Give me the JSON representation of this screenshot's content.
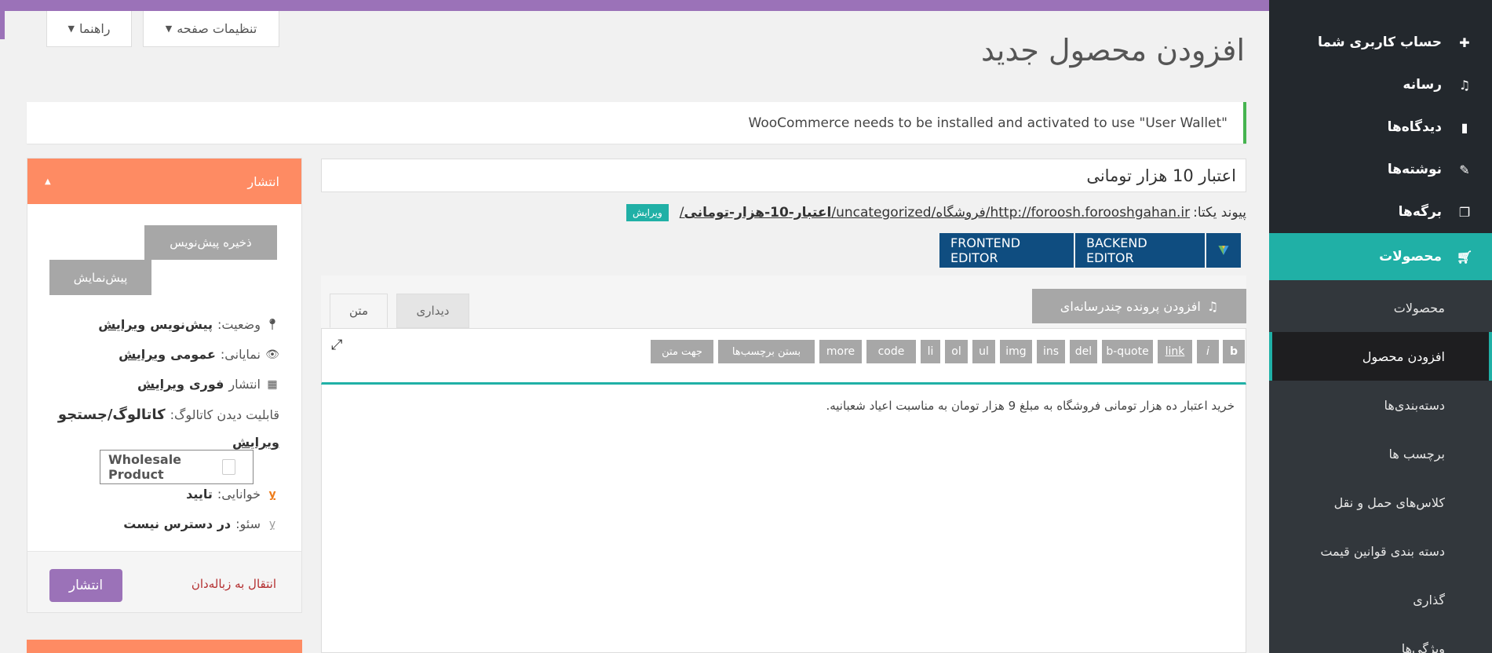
{
  "header": {
    "page_title": "افزودن محصول جدید",
    "screen_options": "تنظیمات صفحه",
    "help": "راهنما"
  },
  "notice": "WooCommerce needs to be installed and activated to use \"User Wallet\"",
  "sidebar": {
    "items": [
      {
        "label": "حساب کاربری شما",
        "icon": "plus-icon"
      },
      {
        "label": "رسانه",
        "icon": "media-icon"
      },
      {
        "label": "دیدگاه‌ها",
        "icon": "comment-icon"
      },
      {
        "label": "نوشته‌ها",
        "icon": "pin-icon"
      },
      {
        "label": "برگه‌ها",
        "icon": "pages-icon"
      }
    ],
    "active": {
      "label": "محصولات",
      "icon": "cart-icon"
    },
    "submenu": [
      "محصولات",
      "افزودن محصول",
      "دسته‌بندی‌ها",
      "برچسب ها",
      "کلاس‌های حمل و نقل",
      "دسته بندی قوانین قیمت",
      "گذاری",
      "ویژگی‌ها"
    ]
  },
  "publish": {
    "title": "انتشار",
    "save_draft": "ذخیره پیش‌نویس",
    "preview": "پیش‌نمایش",
    "status_label": "وضعیت:",
    "status_value": "پیش‌نویس",
    "visibility_label": "نمایانی:",
    "visibility_value": "عمومی",
    "publish_label": "انتشار",
    "publish_value": "فوری",
    "catalog_label": "قابلیت دیدن کاتالوگ:",
    "catalog_value": "کاتالوگ/جستجو",
    "edit": "ویرایش",
    "wholesale": "Wholesale Product",
    "readability_label": "خوانایی:",
    "readability_value": "تایید",
    "seo_label": "سئو:",
    "seo_value": "در دسترس نیست",
    "trash": "انتقال به زباله‌دان",
    "publish_button": "انتشار"
  },
  "editor": {
    "title_value": "اعتبار 10 هزار تومانی",
    "permalink_label": "پیوند یکتا:",
    "permalink_base": "http://foroosh.forooshgahan.ir",
    "permalink_path": "/فروشگاه/uncategorized/",
    "permalink_slug": "اعتبار-10-هزار-تومانی",
    "permalink_end": "/",
    "edit_slug": "ویرایش",
    "backend_editor": "BACKEND EDITOR",
    "frontend_editor": "FRONTEND EDITOR",
    "add_media": "افزودن پرونده چندرسانه‌ای",
    "tab_visual": "دیداری",
    "tab_text": "متن",
    "quicktags": [
      "b",
      "i",
      "link",
      "b-quote",
      "del",
      "ins",
      "img",
      "ul",
      "ol",
      "li",
      "code",
      "more",
      "بستن برچسب‌ها",
      "جهت متن"
    ],
    "content": "خرید اعتبار ده هزار تومانی فروشگاه به مبلغ 9 هزار تومان به مناسبت اعیاد شعبانیه."
  }
}
